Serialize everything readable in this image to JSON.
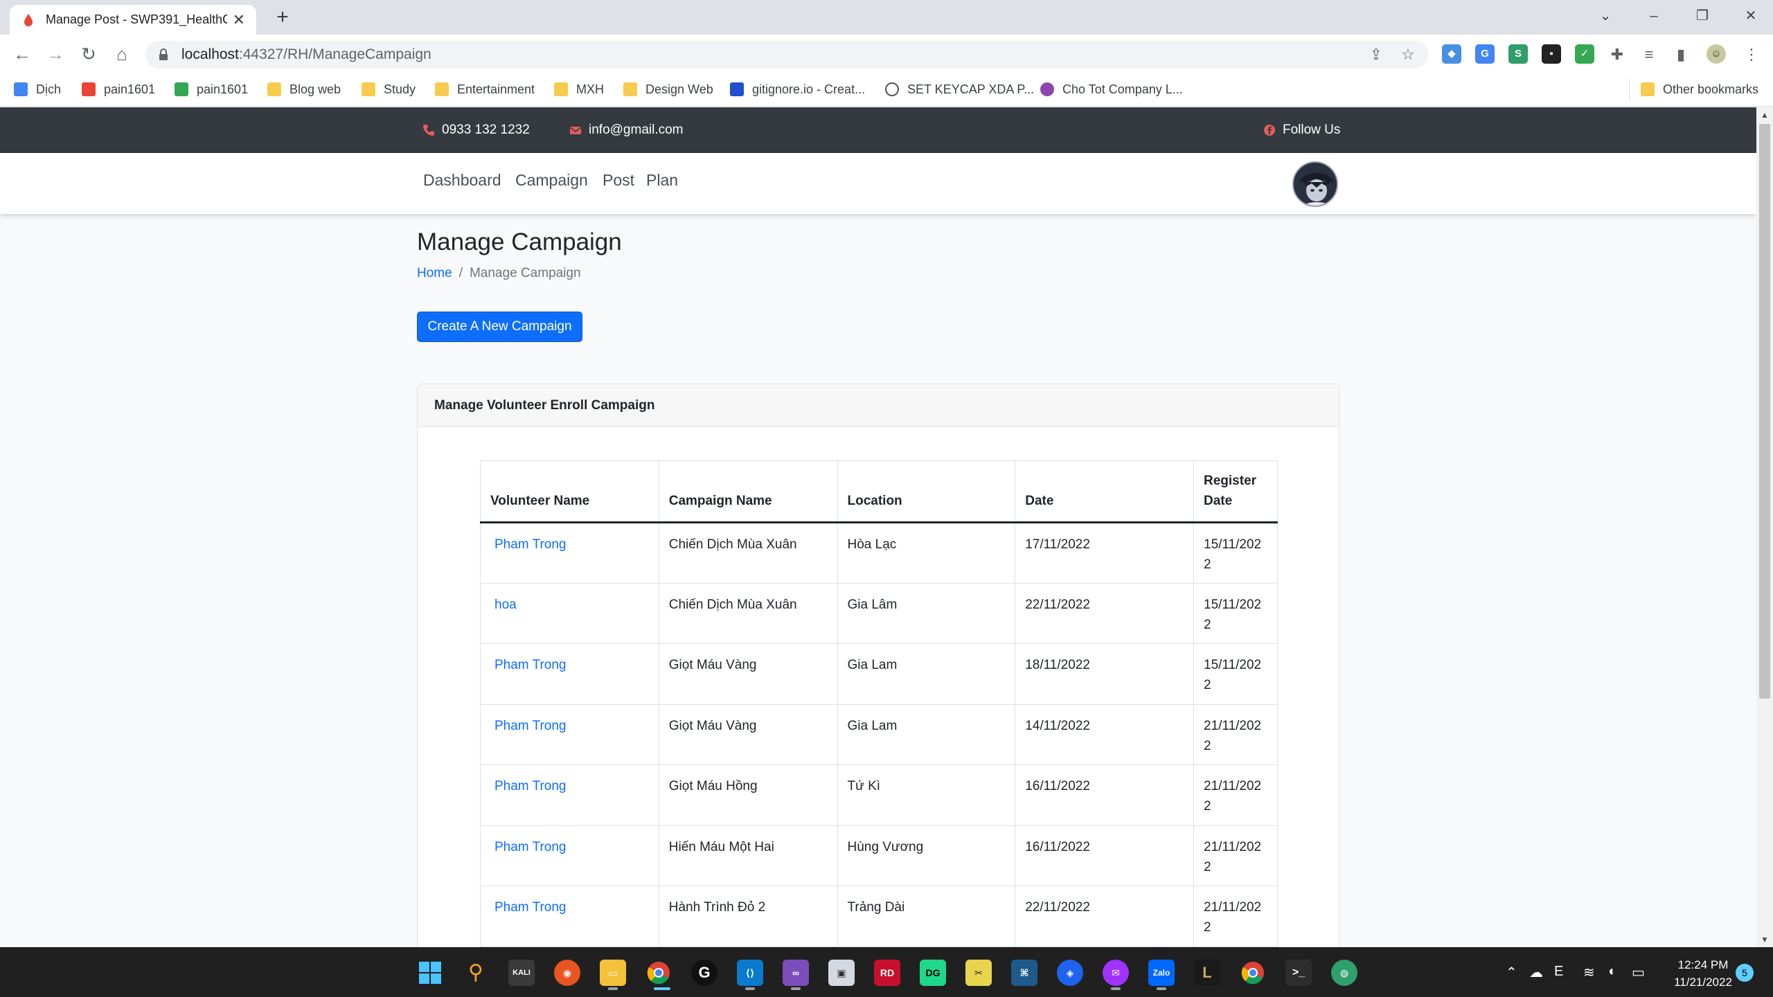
{
  "browser": {
    "tab_title": "Manage Post - SWP391_HealthC",
    "tab_close": "✕",
    "new_tab": "+",
    "url_host": "localhost",
    "url_rest": ":44327/RH/ManageCampaign",
    "window_controls": [
      "⌄",
      "–",
      "❐",
      "✕"
    ]
  },
  "bookmarks": [
    {
      "label": "Dịch",
      "icon": "translate-icon"
    },
    {
      "label": "pain1601",
      "icon": "gmail-icon"
    },
    {
      "label": "pain1601",
      "icon": "drive-icon"
    },
    {
      "label": "Blog web",
      "icon": "folder-icon"
    },
    {
      "label": "Study",
      "icon": "folder-icon"
    },
    {
      "label": "Entertainment",
      "icon": "folder-icon"
    },
    {
      "label": "MXH",
      "icon": "folder-icon"
    },
    {
      "label": "Design Web",
      "icon": "folder-icon"
    },
    {
      "label": "gitignore.io - Creat...",
      "icon": "gitignore-icon"
    },
    {
      "label": "SET KEYCAP XDA P...",
      "icon": "keycap-icon"
    },
    {
      "label": "Cho Tot Company L...",
      "icon": "chotot-icon"
    }
  ],
  "other_bookmarks": "Other bookmarks",
  "topbar": {
    "phone": "0933 132 1232",
    "email": "info@gmail.com",
    "follow": "Follow Us"
  },
  "nav": {
    "items": [
      "Dashboard",
      "Campaign",
      "Post",
      "Plan"
    ]
  },
  "page": {
    "title": "Manage Campaign",
    "breadcrumb_home": "Home",
    "breadcrumb_sep": "/",
    "breadcrumb_current": "Manage Campaign",
    "create_button": "Create A New Campaign"
  },
  "card": {
    "header": "Manage Volunteer Enroll Campaign",
    "columns": [
      "Volunteer Name",
      "Campaign Name",
      "Location",
      "Date",
      "Register Date"
    ],
    "rows": [
      {
        "volunteer": "Pham Trong",
        "campaign": "Chiến Dịch Mùa Xuân",
        "location": "Hòa Lạc",
        "date": "17/11/2022",
        "register": "15/11/2022"
      },
      {
        "volunteer": "hoa",
        "campaign": "Chiến Dịch Mùa Xuân",
        "location": "Gia Lâm",
        "date": "22/11/2022",
        "register": "15/11/2022"
      },
      {
        "volunteer": "Pham Trong",
        "campaign": "Giọt Máu Vàng",
        "location": "Gia Lam",
        "date": "18/11/2022",
        "register": "15/11/2022"
      },
      {
        "volunteer": "Pham Trong",
        "campaign": "Giọt Máu Vàng",
        "location": "Gia Lam",
        "date": "14/11/2022",
        "register": "21/11/2022"
      },
      {
        "volunteer": "Pham Trong",
        "campaign": "Giọt Máu Hồng",
        "location": "Tứ Kì",
        "date": "16/11/2022",
        "register": "21/11/2022"
      },
      {
        "volunteer": "Pham Trong",
        "campaign": "Hiến Máu Một Hai",
        "location": "Hùng Vương",
        "date": "16/11/2022",
        "register": "21/11/2022"
      },
      {
        "volunteer": "Pham Trong",
        "campaign": "Hành Trình Đỏ 2",
        "location": "Trảng Dài",
        "date": "22/11/2022",
        "register": "21/11/2022"
      }
    ]
  },
  "taskbar": {
    "time": "12:24 PM",
    "date": "11/21/2022",
    "notifications": "5",
    "kali_label": "KALI"
  },
  "colors": {
    "primary": "#0d6efd",
    "topbar": "#343a40",
    "taskbar": "#202020"
  }
}
